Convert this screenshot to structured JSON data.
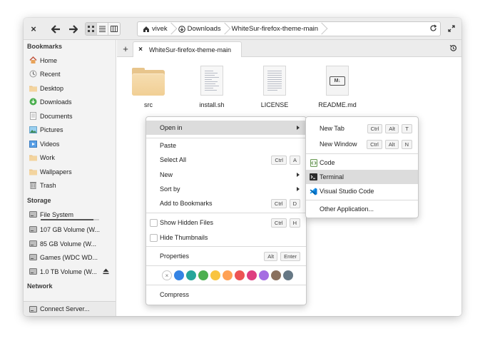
{
  "headerbar": {
    "close_glyph": "×",
    "breadcrumbs": [
      {
        "label": "vivek",
        "icon": "home-icon"
      },
      {
        "label": "Downloads",
        "icon": "download-icon"
      },
      {
        "label": "WhiteSur-firefox-theme-main",
        "icon": ""
      }
    ]
  },
  "sidebar": {
    "bookmarks_heading": "Bookmarks",
    "bookmarks": [
      {
        "label": "Home",
        "icon": "home-icon"
      },
      {
        "label": "Recent",
        "icon": "recent-icon"
      },
      {
        "label": "Desktop",
        "icon": "folder-icon"
      },
      {
        "label": "Downloads",
        "icon": "download-icon"
      },
      {
        "label": "Documents",
        "icon": "document-icon"
      },
      {
        "label": "Pictures",
        "icon": "pictures-icon"
      },
      {
        "label": "Videos",
        "icon": "videos-icon"
      },
      {
        "label": "Work",
        "icon": "folder-icon"
      },
      {
        "label": "Wallpapers",
        "icon": "folder-icon"
      },
      {
        "label": "Trash",
        "icon": "trash-icon"
      }
    ],
    "storage_heading": "Storage",
    "storage": [
      {
        "label": "File System",
        "usage": 0.9
      },
      {
        "label": "107 GB Volume (W..."
      },
      {
        "label": "85 GB Volume (W..."
      },
      {
        "label": "Games (WDC  WD..."
      },
      {
        "label": "1.0 TB Volume (W...",
        "ejectable": true
      }
    ],
    "network_heading": "Network",
    "connect_server": "Connect Server..."
  },
  "tabbar": {
    "add_glyph": "+",
    "tab_close_glyph": "×",
    "tab_label": "WhiteSur-firefox-theme-main"
  },
  "files": [
    {
      "name": "src",
      "type": "folder"
    },
    {
      "name": "install.sh",
      "type": "script"
    },
    {
      "name": "LICENSE",
      "type": "text"
    },
    {
      "name": "README.md",
      "type": "markdown",
      "badge": "M↓"
    }
  ],
  "context_menu": {
    "open_in": "Open in",
    "paste": "Paste",
    "select_all": "Select All",
    "select_all_keys": [
      "Ctrl",
      "A"
    ],
    "new": "New",
    "sort_by": "Sort by",
    "add_bookmarks": "Add to Bookmarks",
    "add_bookmarks_keys": [
      "Ctrl",
      "D"
    ],
    "show_hidden": "Show Hidden Files",
    "show_hidden_keys": [
      "Ctrl",
      "H"
    ],
    "hide_thumbnails": "Hide Thumbnails",
    "properties": "Properties",
    "properties_keys": [
      "Alt",
      "Enter"
    ],
    "tag_colors": [
      "#3584e4",
      "#26a69a",
      "#4caf50",
      "#f9c440",
      "#ffa154",
      "#ed5353",
      "#de3e80",
      "#a56de2",
      "#8a715e",
      "#667885"
    ],
    "clear_tag_glyph": "×",
    "compress": "Compress"
  },
  "submenu": {
    "new_tab": "New Tab",
    "new_tab_keys": [
      "Ctrl",
      "Alt",
      "T"
    ],
    "new_window": "New Window",
    "new_window_keys": [
      "Ctrl",
      "Alt",
      "N"
    ],
    "apps": [
      {
        "label": "Code",
        "icon": "code-icon"
      },
      {
        "label": "Terminal",
        "icon": "terminal-icon",
        "highlighted": true
      },
      {
        "label": "Visual Studio Code",
        "icon": "vscode-icon"
      }
    ],
    "other_application": "Other Application..."
  }
}
